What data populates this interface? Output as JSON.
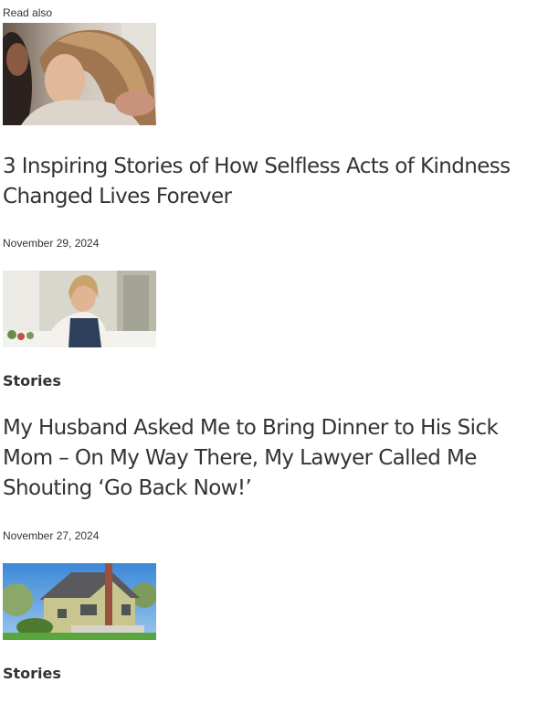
{
  "section_label": "Read also",
  "articles": [
    {
      "title": "3 Inspiring Stories of How Selfless Acts of Kindness Changed Lives Forever",
      "title_line1": "3 Inspiring Stories of How Selfless Acts of Kindness",
      "title_line2": "Changed Lives Forever",
      "date": "November 29, 2024",
      "thumbnail": "photo-woman-comforted"
    },
    {
      "category": "Stories",
      "title_line1": "My Husband Asked Me to Bring Dinner to His Sick",
      "title_line2": "Mom – On My Way There, My Lawyer Called Me",
      "title_line3": "Shouting ‘Go Back Now!’",
      "date": "November 27, 2024",
      "thumbnail": "photo-woman-cooking"
    },
    {
      "category": "Stories",
      "thumbnail": "photo-house"
    }
  ]
}
